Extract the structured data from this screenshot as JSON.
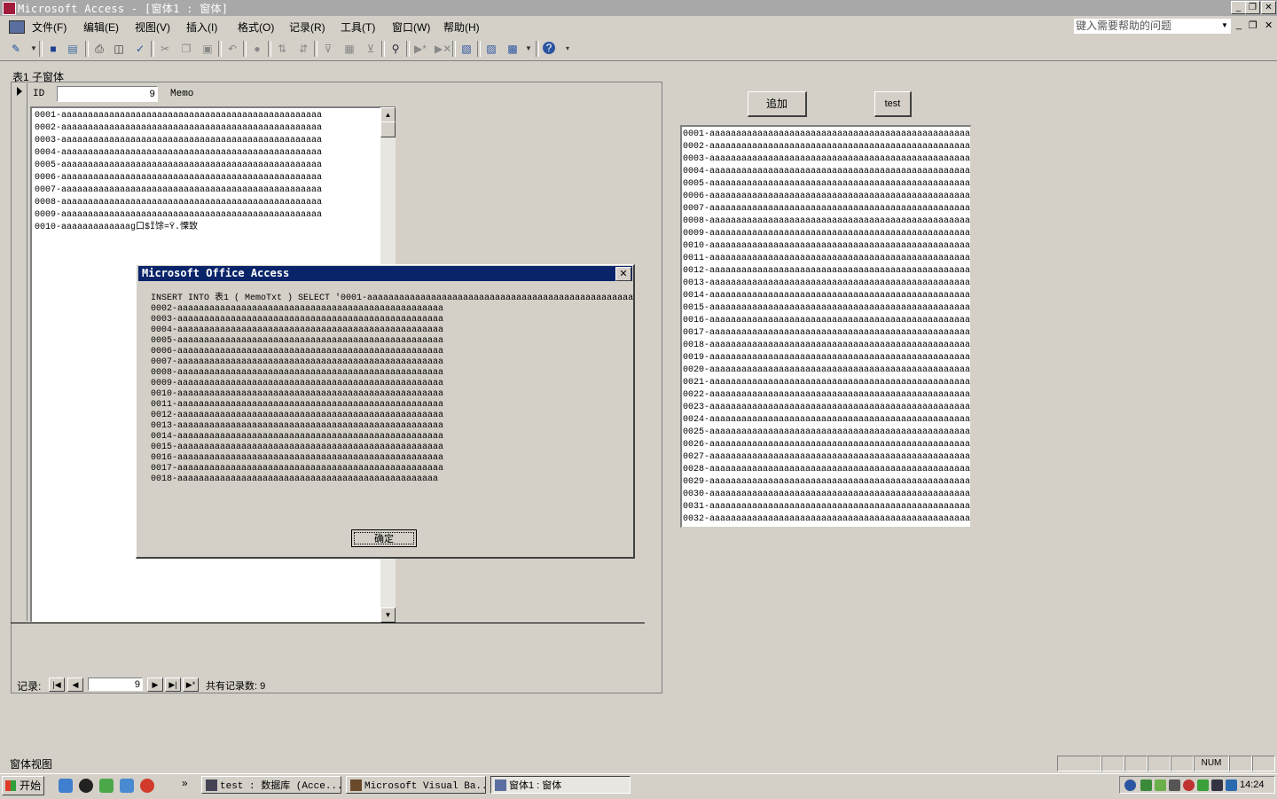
{
  "window": {
    "title": "Microsoft Access - [窗体1 : 窗体]",
    "controls": {
      "minimize": "_",
      "restore": "❐",
      "close": "✕"
    }
  },
  "menu": {
    "items": [
      "文件(F)",
      "编辑(E)",
      "视图(V)",
      "插入(I)",
      "格式(O)",
      "记录(R)",
      "工具(T)",
      "窗口(W)",
      "帮助(H)"
    ],
    "help_placeholder": "键入需要帮助的问题"
  },
  "toolbar": {
    "icons": [
      "design-view-icon",
      "save-icon",
      "file-search-icon",
      "print-icon",
      "print-preview-icon",
      "spelling-icon",
      "cut-icon",
      "copy-icon",
      "paste-icon",
      "undo-icon",
      "hyperlink-icon",
      "sort-ascending-icon",
      "sort-descending-icon",
      "filter-by-selection-icon",
      "filter-by-form-icon",
      "apply-filter-icon",
      "find-icon",
      "new-record-icon",
      "delete-record-icon",
      "properties-icon",
      "database-window-icon",
      "new-object-icon",
      "help-icon"
    ]
  },
  "subform": {
    "label": "表1 子窗体",
    "id_label": "ID",
    "id_value": "9",
    "memo_label": "Memo",
    "memo_lines": [
      "0001-aaaaaaaaaaaaaaaaaaaaaaaaaaaaaaaaaaaaaaaaaaaaaaaaa",
      "0002-aaaaaaaaaaaaaaaaaaaaaaaaaaaaaaaaaaaaaaaaaaaaaaaaa",
      "0003-aaaaaaaaaaaaaaaaaaaaaaaaaaaaaaaaaaaaaaaaaaaaaaaaa",
      "0004-aaaaaaaaaaaaaaaaaaaaaaaaaaaaaaaaaaaaaaaaaaaaaaaaa",
      "0005-aaaaaaaaaaaaaaaaaaaaaaaaaaaaaaaaaaaaaaaaaaaaaaaaa",
      "0006-aaaaaaaaaaaaaaaaaaaaaaaaaaaaaaaaaaaaaaaaaaaaaaaaa",
      "0007-aaaaaaaaaaaaaaaaaaaaaaaaaaaaaaaaaaaaaaaaaaaaaaaaa",
      "0008-aaaaaaaaaaaaaaaaaaaaaaaaaaaaaaaaaaaaaaaaaaaaaaaaa",
      "0009-aaaaaaaaaaaaaaaaaaaaaaaaaaaaaaaaaaaaaaaaaaaaaaaaa",
      "0010-aaaaaaaaaaaaag口$Ĩ馀=Ÿ.慄致"
    ],
    "nav": {
      "label": "记录:",
      "first": "|◀",
      "prev": "◀",
      "current": "9",
      "next": "▶",
      "last": "▶|",
      "new": "▶*",
      "total": "共有记录数: 9"
    }
  },
  "buttons": {
    "add": "追加",
    "test": "test"
  },
  "right_list": [
    "0001-aaaaaaaaaaaaaaaaaaaaaaaaaaaaaaaaaaaaaaaaaaaaaaaaaa",
    "0002-aaaaaaaaaaaaaaaaaaaaaaaaaaaaaaaaaaaaaaaaaaaaaaaaaa",
    "0003-aaaaaaaaaaaaaaaaaaaaaaaaaaaaaaaaaaaaaaaaaaaaaaaaaa",
    "0004-aaaaaaaaaaaaaaaaaaaaaaaaaaaaaaaaaaaaaaaaaaaaaaaaaa",
    "0005-aaaaaaaaaaaaaaaaaaaaaaaaaaaaaaaaaaaaaaaaaaaaaaaaaa",
    "0006-aaaaaaaaaaaaaaaaaaaaaaaaaaaaaaaaaaaaaaaaaaaaaaaaaa",
    "0007-aaaaaaaaaaaaaaaaaaaaaaaaaaaaaaaaaaaaaaaaaaaaaaaaaa",
    "0008-aaaaaaaaaaaaaaaaaaaaaaaaaaaaaaaaaaaaaaaaaaaaaaaaaa",
    "0009-aaaaaaaaaaaaaaaaaaaaaaaaaaaaaaaaaaaaaaaaaaaaaaaaaa",
    "0010-aaaaaaaaaaaaaaaaaaaaaaaaaaaaaaaaaaaaaaaaaaaaaaaaaa",
    "0011-aaaaaaaaaaaaaaaaaaaaaaaaaaaaaaaaaaaaaaaaaaaaaaaaaa",
    "0012-aaaaaaaaaaaaaaaaaaaaaaaaaaaaaaaaaaaaaaaaaaaaaaaaaa",
    "0013-aaaaaaaaaaaaaaaaaaaaaaaaaaaaaaaaaaaaaaaaaaaaaaaaaa",
    "0014-aaaaaaaaaaaaaaaaaaaaaaaaaaaaaaaaaaaaaaaaaaaaaaaaaa",
    "0015-aaaaaaaaaaaaaaaaaaaaaaaaaaaaaaaaaaaaaaaaaaaaaaaaaa",
    "0016-aaaaaaaaaaaaaaaaaaaaaaaaaaaaaaaaaaaaaaaaaaaaaaaaaa",
    "0017-aaaaaaaaaaaaaaaaaaaaaaaaaaaaaaaaaaaaaaaaaaaaaaaaaa",
    "0018-aaaaaaaaaaaaaaaaaaaaaaaaaaaaaaaaaaaaaaaaaaaaaaaaaa",
    "0019-aaaaaaaaaaaaaaaaaaaaaaaaaaaaaaaaaaaaaaaaaaaaaaaaaa",
    "0020-aaaaaaaaaaaaaaaaaaaaaaaaaaaaaaaaaaaaaaaaaaaaaaaaaa",
    "0021-aaaaaaaaaaaaaaaaaaaaaaaaaaaaaaaaaaaaaaaaaaaaaaaaaa",
    "0022-aaaaaaaaaaaaaaaaaaaaaaaaaaaaaaaaaaaaaaaaaaaaaaaaaa",
    "0023-aaaaaaaaaaaaaaaaaaaaaaaaaaaaaaaaaaaaaaaaaaaaaaaaaa",
    "0024-aaaaaaaaaaaaaaaaaaaaaaaaaaaaaaaaaaaaaaaaaaaaaaaaaa",
    "0025-aaaaaaaaaaaaaaaaaaaaaaaaaaaaaaaaaaaaaaaaaaaaaaaaaa",
    "0026-aaaaaaaaaaaaaaaaaaaaaaaaaaaaaaaaaaaaaaaaaaaaaaaaaa",
    "0027-aaaaaaaaaaaaaaaaaaaaaaaaaaaaaaaaaaaaaaaaaaaaaaaaaa",
    "0028-aaaaaaaaaaaaaaaaaaaaaaaaaaaaaaaaaaaaaaaaaaaaaaaaaa",
    "0029-aaaaaaaaaaaaaaaaaaaaaaaaaaaaaaaaaaaaaaaaaaaaaaaaaa",
    "0030-aaaaaaaaaaaaaaaaaaaaaaaaaaaaaaaaaaaaaaaaaaaaaaaaaa",
    "0031-aaaaaaaaaaaaaaaaaaaaaaaaaaaaaaaaaaaaaaaaaaaaaaaaaa",
    "0032-aaaaaaaaaaaaaaaaaaaaaaaaaaaaaaaaaaaaaaaaaaaaaaaaaa"
  ],
  "dialog": {
    "title": "Microsoft Office Access",
    "close": "✕",
    "lines": [
      "INSERT INTO 表1 ( MemoTxt ) SELECT '0001-aaaaaaaaaaaaaaaaaaaaaaaaaaaaaaaaaaaaaaaaaaaaaaaaaa",
      "0002-aaaaaaaaaaaaaaaaaaaaaaaaaaaaaaaaaaaaaaaaaaaaaaaaaa",
      "0003-aaaaaaaaaaaaaaaaaaaaaaaaaaaaaaaaaaaaaaaaaaaaaaaaaa",
      "0004-aaaaaaaaaaaaaaaaaaaaaaaaaaaaaaaaaaaaaaaaaaaaaaaaaa",
      "0005-aaaaaaaaaaaaaaaaaaaaaaaaaaaaaaaaaaaaaaaaaaaaaaaaaa",
      "0006-aaaaaaaaaaaaaaaaaaaaaaaaaaaaaaaaaaaaaaaaaaaaaaaaaa",
      "0007-aaaaaaaaaaaaaaaaaaaaaaaaaaaaaaaaaaaaaaaaaaaaaaaaaa",
      "0008-aaaaaaaaaaaaaaaaaaaaaaaaaaaaaaaaaaaaaaaaaaaaaaaaaa",
      "0009-aaaaaaaaaaaaaaaaaaaaaaaaaaaaaaaaaaaaaaaaaaaaaaaaaa",
      "0010-aaaaaaaaaaaaaaaaaaaaaaaaaaaaaaaaaaaaaaaaaaaaaaaaaa",
      "0011-aaaaaaaaaaaaaaaaaaaaaaaaaaaaaaaaaaaaaaaaaaaaaaaaaa",
      "0012-aaaaaaaaaaaaaaaaaaaaaaaaaaaaaaaaaaaaaaaaaaaaaaaaaa",
      "0013-aaaaaaaaaaaaaaaaaaaaaaaaaaaaaaaaaaaaaaaaaaaaaaaaaa",
      "0014-aaaaaaaaaaaaaaaaaaaaaaaaaaaaaaaaaaaaaaaaaaaaaaaaaa",
      "0015-aaaaaaaaaaaaaaaaaaaaaaaaaaaaaaaaaaaaaaaaaaaaaaaaaa",
      "0016-aaaaaaaaaaaaaaaaaaaaaaaaaaaaaaaaaaaaaaaaaaaaaaaaaa",
      "0017-aaaaaaaaaaaaaaaaaaaaaaaaaaaaaaaaaaaaaaaaaaaaaaaaaa",
      "0018-aaaaaaaaaaaaaaaaaaaaaaaaaaaaaaaaaaaaaaaaaaaaaaaaa"
    ],
    "ok": "确定"
  },
  "status": {
    "text": "窗体视图",
    "num": "NUM"
  },
  "taskbar": {
    "start": "开始",
    "more": "»",
    "tasks": [
      {
        "label": "test : 数据库 (Acce..."
      },
      {
        "label": "Microsoft Visual Ba..."
      },
      {
        "label": "窗体1 : 窗体"
      }
    ],
    "clock": "14:24"
  }
}
